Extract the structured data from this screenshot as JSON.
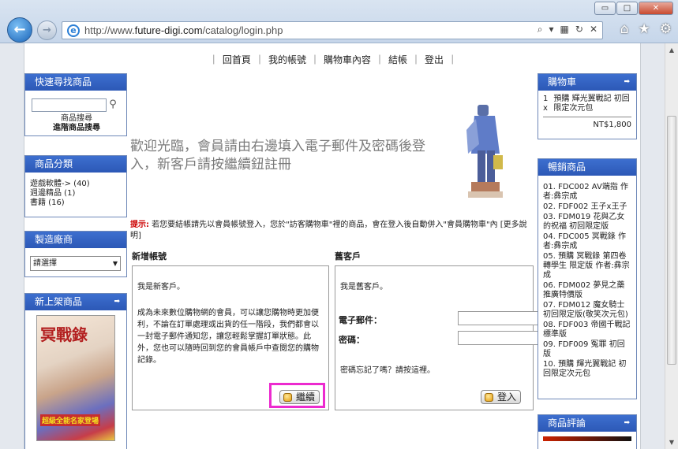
{
  "browser": {
    "url_prefix": "http://www.",
    "url_domain": "future-digi.com",
    "url_path": "/catalog/login.php",
    "window_buttons": [
      "▭",
      "□",
      "✕"
    ],
    "back_glyph": "←",
    "forward_glyph": "→"
  },
  "topnav": {
    "items": [
      "回首頁",
      "我的帳號",
      "購物車內容",
      "結帳",
      "登出"
    ]
  },
  "left": {
    "quick_search": {
      "title": "快速尋找商品",
      "link1": "商品搜尋",
      "link2": "進階商品搜尋"
    },
    "categories": {
      "title": "商品分類",
      "items": [
        "遊戲軟體-> (40)",
        "週邊精品 (1)",
        "書籍 (16)"
      ]
    },
    "manufacturers": {
      "title": "製造廠商",
      "selected": "請選擇"
    },
    "new_products": {
      "title": "新上架商品",
      "cover_title": "冥戰錄",
      "cover_banner": "超級全能名家登場"
    }
  },
  "center": {
    "welcome": "歡迎光臨，會員請由右邊填入電子郵件及密碼後登入，新客戶請按繼續鈕註冊",
    "hint_label": "提示:",
    "hint_text": " 若您要結帳請先以會員帳號登入，您於\"訪客購物車\"裡的商品，會在登入後自動併入\"會員購物車\"內 [更多說明]",
    "new_account": {
      "title": "新增帳號",
      "line1": "我是新客戶。",
      "line2": "成為未來數位購物網的會員，可以讓您購物時更加便利，不論在訂單處理或出貨的任一階段，我們都會以一封電子郵件通知您，讓您輕鬆掌握訂單狀態。此外，您也可以隨時回到您的會員帳戶中查閱您的購物記錄。",
      "continue_label": "繼續"
    },
    "returning": {
      "title": "舊客戶",
      "line1": "我是舊客戶。",
      "email_label": "電子郵件：",
      "password_label": "密碼：",
      "forgot": "密碼忘記了嗎？請按這裡。",
      "login_label": "登入"
    }
  },
  "right": {
    "cart": {
      "title": "購物車",
      "qty": "1 x",
      "item": "預購 輝光翼戰記 初回限定次元包",
      "total": "NT$1,800"
    },
    "bestsellers": {
      "title": "暢銷商品",
      "items": [
        "01. FDC002 AV端指 作者:彝宗成",
        "02. FDF002 王子x王子",
        "03. FDM019 花與乙女的祝福 初回限定版",
        "04. FDC005 冥戰錄 作者:彝宗成",
        "05. 預購 冥戰錄 第四卷 轉學生 限定版 作者:彝宗成",
        "06. FDM002 夢見之藥 推廣特價版",
        "07. FDM012 魔女騎士 初回限定版(敬笑次元包)",
        "08. FDF003 帝國千戰記 標準版",
        "09. FDF009 冤罪 初回版",
        "10. 預購 輝光翼戰記 初回限定次元包"
      ]
    },
    "reviews": {
      "title": "商品評論"
    }
  }
}
